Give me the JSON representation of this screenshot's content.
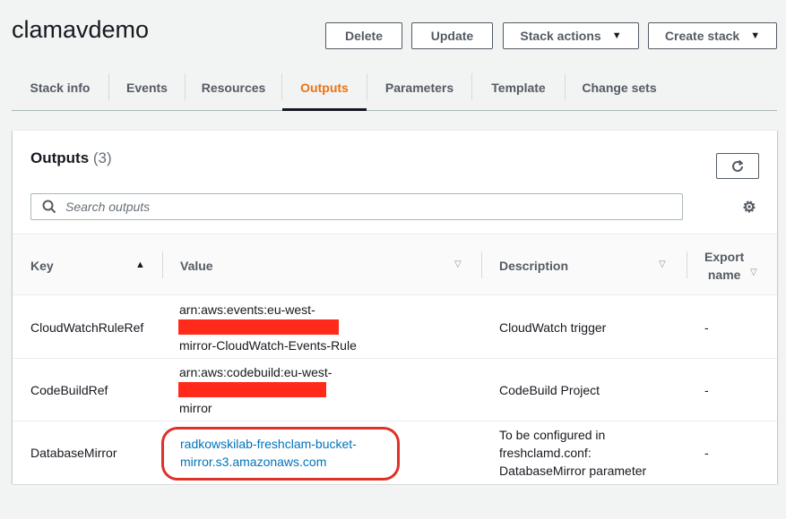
{
  "stack": {
    "title": "clamavdemo"
  },
  "buttons": {
    "delete": "Delete",
    "update": "Update",
    "stack_actions": "Stack actions",
    "create_stack": "Create stack"
  },
  "tabs": [
    {
      "label": "Stack info",
      "active": false
    },
    {
      "label": "Events",
      "active": false
    },
    {
      "label": "Resources",
      "active": false
    },
    {
      "label": "Outputs",
      "active": true
    },
    {
      "label": "Parameters",
      "active": false
    },
    {
      "label": "Template",
      "active": false
    },
    {
      "label": "Change sets",
      "active": false
    }
  ],
  "outputs": {
    "title": "Outputs",
    "count": "(3)",
    "search_placeholder": "Search outputs",
    "columns": {
      "key": "Key",
      "value": "Value",
      "description": "Description",
      "export_name": "Export\nname"
    },
    "rows": [
      {
        "key": "CloudWatchRuleRef",
        "value": "arn:aws:events:eu-west-\n                                   kowski-freshclam-\nmirror-CloudWatch-Events-Rule",
        "description": "CloudWatch trigger",
        "export_name": "-"
      },
      {
        "key": "CodeBuildRef",
        "value": "arn:aws:codebuild:eu-west-\n                                   radkowski-freshclam-\nmirror",
        "description": "CodeBuild Project",
        "export_name": "-"
      },
      {
        "key": "DatabaseMirror",
        "value": "radkowskilab-freshclam-bucket-\nmirror.s3.amazonaws.com",
        "description": "To be configured in\nfreshclamd.conf:\nDatabaseMirror parameter",
        "export_name": "-"
      }
    ]
  },
  "colors": {
    "accent": "#ec7211",
    "link": "#0073bb",
    "redaction": "#ff2a1a",
    "highlight": "#e0302a"
  }
}
